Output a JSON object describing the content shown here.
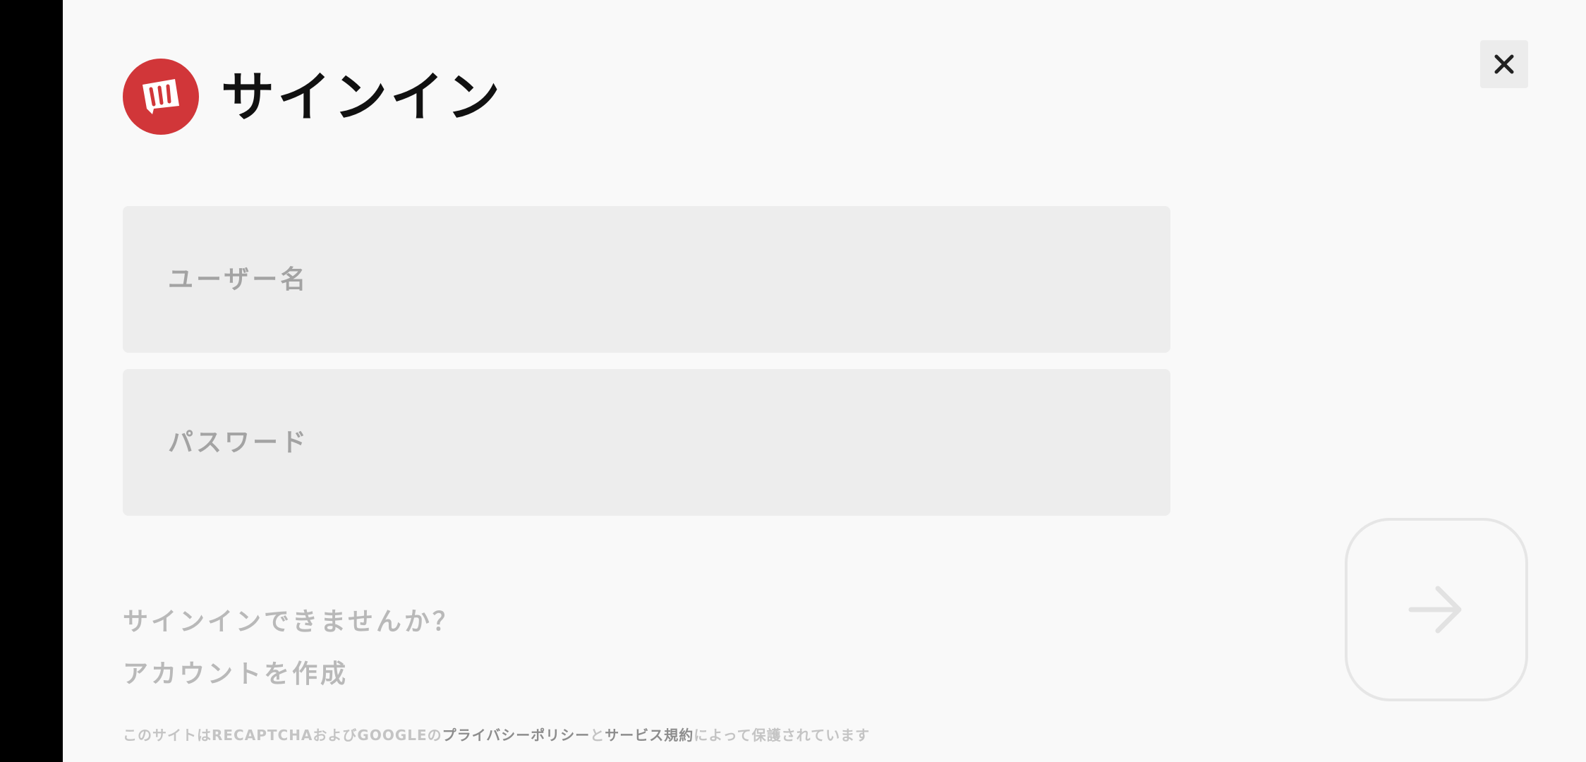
{
  "header": {
    "title": "サインイン",
    "logo_icon": "riot-fist-icon",
    "close_icon": "close-icon"
  },
  "form": {
    "username_placeholder": "ユーザー名",
    "username_value": "",
    "password_placeholder": "パスワード",
    "password_value": ""
  },
  "links": {
    "cant_signin": "サインインできませんか？",
    "create_account": "アカウントを作成"
  },
  "submit": {
    "icon": "arrow-right-icon"
  },
  "recaptcha": {
    "prefix": "このサイトはRECAPTCHAおよびGOOGLEの",
    "privacy_link": "プライバシーポリシー",
    "and": "と",
    "terms_link": "サービス規約",
    "suffix": "によって保護されています"
  },
  "colors": {
    "brand_red": "#d13639",
    "background": "#f9f9f9",
    "field_bg": "#ededed"
  }
}
